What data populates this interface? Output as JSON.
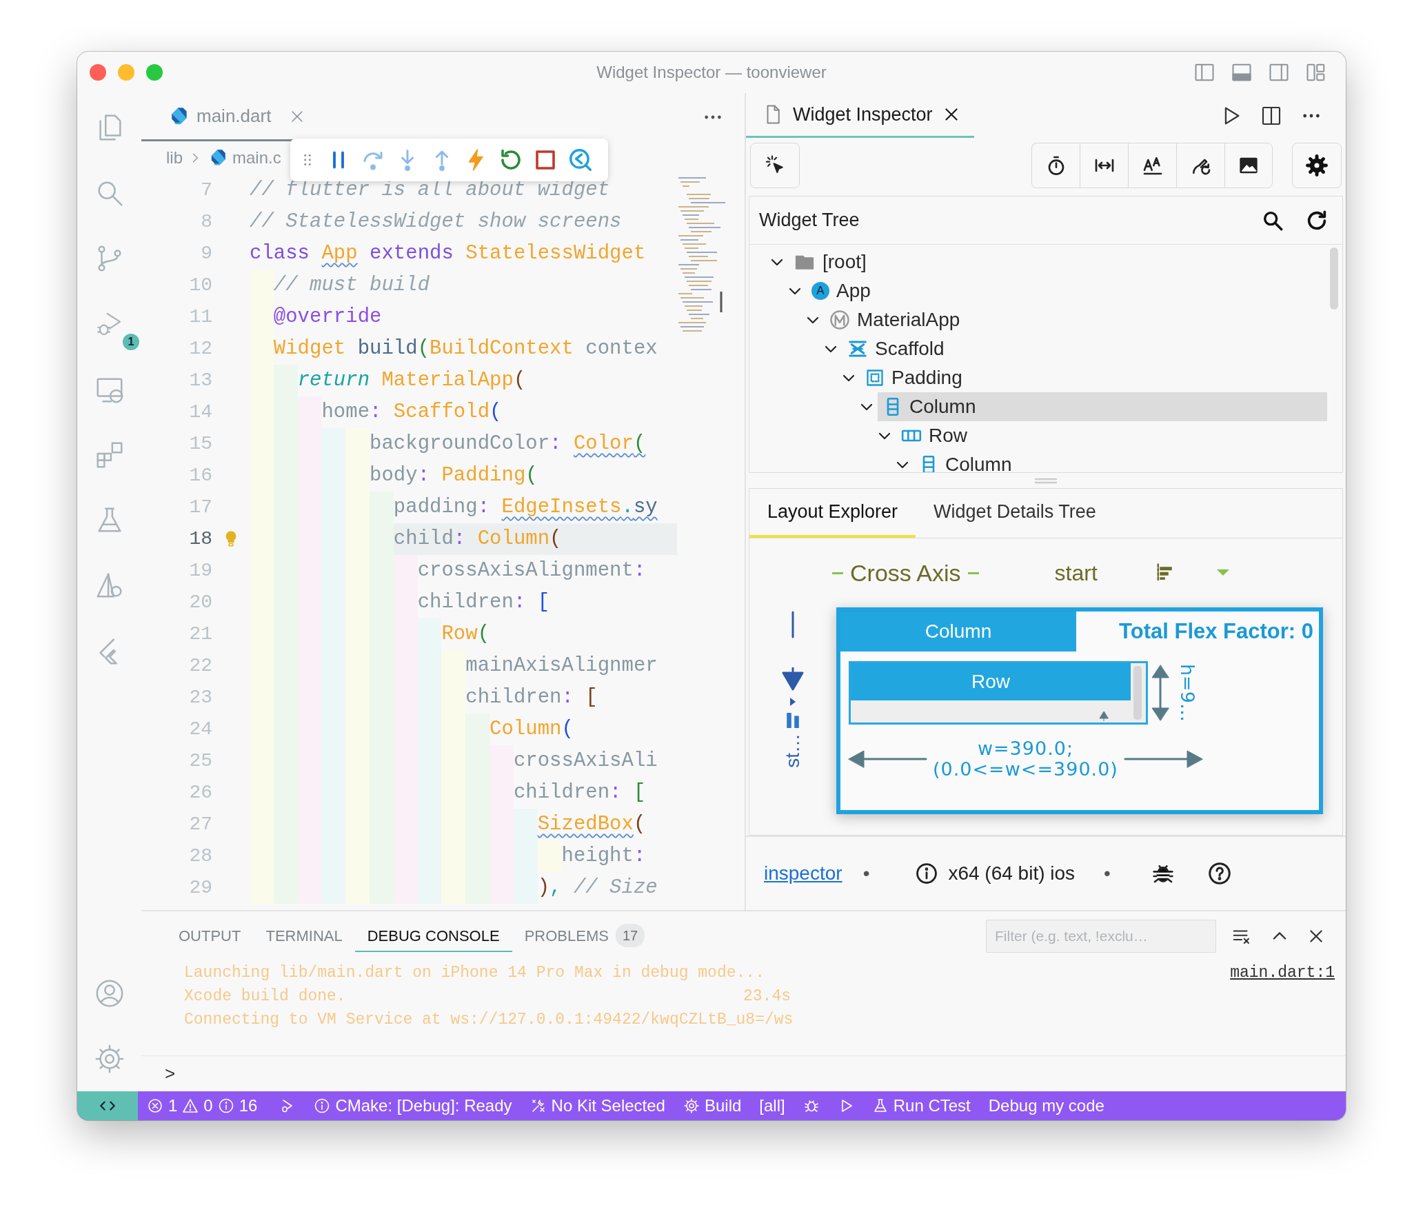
{
  "window": {
    "title": "Widget Inspector — toonviewer"
  },
  "activity_bar": {
    "debug_badge": "1"
  },
  "editor": {
    "tab": "main.dart",
    "breadcrumb": {
      "folder": "lib",
      "file": "main.c"
    },
    "lines": [
      {
        "number": "7",
        "current": false,
        "lightbulb": false,
        "tokens": [
          {
            "text": "// flutter is all about widget",
            "kind": "comment",
            "warning": false
          }
        ]
      },
      {
        "number": "8",
        "current": false,
        "lightbulb": false,
        "tokens": [
          {
            "text": "// StatelessWidget show screens",
            "kind": "comment",
            "warning": false
          }
        ]
      },
      {
        "number": "9",
        "current": false,
        "lightbulb": false,
        "tokens": [
          {
            "text": "class ",
            "kind": "keyword",
            "warning": false
          },
          {
            "text": "App",
            "kind": "type",
            "warning": true
          },
          {
            "text": " extends ",
            "kind": "keyword",
            "warning": false
          },
          {
            "text": "StatelessWidget",
            "kind": "type",
            "warning": false
          }
        ]
      },
      {
        "number": "10",
        "current": false,
        "lightbulb": false,
        "tokens": [
          {
            "text": "  // must build",
            "kind": "comment",
            "warning": false
          }
        ]
      },
      {
        "number": "11",
        "current": false,
        "lightbulb": false,
        "tokens": [
          {
            "text": "  @override",
            "kind": "annotation",
            "warning": false
          }
        ]
      },
      {
        "number": "12",
        "current": false,
        "lightbulb": false,
        "tokens": [
          {
            "text": "  Widget",
            "kind": "type",
            "warning": false
          },
          {
            "text": " build",
            "kind": "method",
            "warning": false
          },
          {
            "text": "(",
            "kind": "bracket",
            "color": "#2e8b3a",
            "warning": false
          },
          {
            "text": "BuildContext",
            "kind": "type",
            "warning": false
          },
          {
            "text": " contex",
            "kind": "plain",
            "warning": false
          }
        ]
      },
      {
        "number": "13",
        "current": false,
        "lightbulb": false,
        "tokens": [
          {
            "text": "    return",
            "kind": "control",
            "warning": false
          },
          {
            "text": " MaterialApp",
            "kind": "type",
            "warning": false
          },
          {
            "text": "(",
            "kind": "bracket",
            "color": "#7a3e1d",
            "warning": false
          }
        ]
      },
      {
        "number": "14",
        "current": false,
        "lightbulb": false,
        "tokens": [
          {
            "text": "      home",
            "kind": "plain",
            "warning": false
          },
          {
            "text": ": ",
            "kind": "punct",
            "warning": false
          },
          {
            "text": "Scaffold",
            "kind": "type",
            "warning": false
          },
          {
            "text": "(",
            "kind": "bracket",
            "color": "#1f4fe0",
            "warning": false
          }
        ]
      },
      {
        "number": "15",
        "current": false,
        "lightbulb": false,
        "tokens": [
          {
            "text": "          backgroundColor",
            "kind": "plain",
            "warning": false
          },
          {
            "text": ": ",
            "kind": "punct",
            "warning": false
          },
          {
            "text": "Color",
            "kind": "type",
            "warning": true
          },
          {
            "text": "(",
            "kind": "bracket",
            "color": "#2e8b3a",
            "warning": true
          }
        ]
      },
      {
        "number": "16",
        "current": false,
        "lightbulb": false,
        "tokens": [
          {
            "text": "          body",
            "kind": "plain",
            "warning": false
          },
          {
            "text": ": ",
            "kind": "punct",
            "warning": false
          },
          {
            "text": "Padding",
            "kind": "type",
            "warning": false
          },
          {
            "text": "(",
            "kind": "bracket",
            "color": "#2e8b3a",
            "warning": false
          }
        ]
      },
      {
        "number": "17",
        "current": false,
        "lightbulb": false,
        "tokens": [
          {
            "text": "            padding",
            "kind": "plain",
            "warning": false
          },
          {
            "text": ": ",
            "kind": "punct",
            "warning": false
          },
          {
            "text": "EdgeInsets",
            "kind": "type",
            "warning": true
          },
          {
            "text": ".",
            "kind": "dot",
            "warning": true
          },
          {
            "text": "sy",
            "kind": "method",
            "warning": true
          }
        ]
      },
      {
        "number": "18",
        "current": true,
        "lightbulb": true,
        "tokens": [
          {
            "text": "            child",
            "kind": "plain",
            "warning": false
          },
          {
            "text": ": ",
            "kind": "punct",
            "warning": false
          },
          {
            "text": "Column",
            "kind": "type",
            "warning": false
          },
          {
            "text": "(",
            "kind": "bracket",
            "color": "#7a3e1d",
            "warning": false
          }
        ]
      },
      {
        "number": "19",
        "current": false,
        "lightbulb": false,
        "tokens": [
          {
            "text": "              crossAxisAlignment",
            "kind": "plain",
            "warning": false
          },
          {
            "text": ":",
            "kind": "punct",
            "warning": false
          }
        ]
      },
      {
        "number": "20",
        "current": false,
        "lightbulb": false,
        "tokens": [
          {
            "text": "              children",
            "kind": "plain",
            "warning": false
          },
          {
            "text": ": ",
            "kind": "punct",
            "warning": false
          },
          {
            "text": "[",
            "kind": "bracket",
            "color": "#1f4fe0",
            "warning": false
          }
        ]
      },
      {
        "number": "21",
        "current": false,
        "lightbulb": false,
        "tokens": [
          {
            "text": "                Row",
            "kind": "type",
            "warning": false
          },
          {
            "text": "(",
            "kind": "bracket",
            "color": "#2e8b3a",
            "warning": false
          }
        ]
      },
      {
        "number": "22",
        "current": false,
        "lightbulb": false,
        "tokens": [
          {
            "text": "                  mainAxisAlignmer",
            "kind": "plain",
            "warning": false
          }
        ]
      },
      {
        "number": "23",
        "current": false,
        "lightbulb": false,
        "tokens": [
          {
            "text": "                  children",
            "kind": "plain",
            "warning": false
          },
          {
            "text": ": ",
            "kind": "punct",
            "warning": false
          },
          {
            "text": "[",
            "kind": "bracket",
            "color": "#7a3e1d",
            "warning": false
          }
        ]
      },
      {
        "number": "24",
        "current": false,
        "lightbulb": false,
        "tokens": [
          {
            "text": "                    Column",
            "kind": "type",
            "warning": false
          },
          {
            "text": "(",
            "kind": "bracket",
            "color": "#1f4fe0",
            "warning": false
          }
        ]
      },
      {
        "number": "25",
        "current": false,
        "lightbulb": false,
        "tokens": [
          {
            "text": "                      crossAxisAli",
            "kind": "plain",
            "warning": false
          }
        ]
      },
      {
        "number": "26",
        "current": false,
        "lightbulb": false,
        "tokens": [
          {
            "text": "                      children",
            "kind": "plain",
            "warning": false
          },
          {
            "text": ": ",
            "kind": "punct",
            "warning": false
          },
          {
            "text": "[",
            "kind": "bracket",
            "color": "#2e8b3a",
            "warning": false
          }
        ]
      },
      {
        "number": "27",
        "current": false,
        "lightbulb": false,
        "tokens": [
          {
            "text": "                        SizedBox",
            "kind": "type",
            "warning": true
          },
          {
            "text": "(",
            "kind": "bracket",
            "color": "#7a3e1d",
            "warning": false
          }
        ]
      },
      {
        "number": "28",
        "current": false,
        "lightbulb": false,
        "tokens": [
          {
            "text": "                          height",
            "kind": "plain",
            "warning": false
          },
          {
            "text": ":",
            "kind": "punct",
            "warning": false
          }
        ]
      },
      {
        "number": "29",
        "current": false,
        "lightbulb": false,
        "tokens": [
          {
            "text": "                        )",
            "kind": "bracket",
            "color": "#7a3e1d",
            "warning": false
          },
          {
            "text": ",",
            "kind": "dot",
            "warning": false
          },
          {
            "text": " // Size",
            "kind": "comment",
            "warning": false
          }
        ]
      }
    ]
  },
  "inspector": {
    "tab": "Widget Inspector",
    "tree": {
      "title": "Widget Tree",
      "nodes": [
        {
          "label": "[root]",
          "kind": "folder",
          "expanded": true,
          "selected": false,
          "children": [
            {
              "label": "App",
              "kind": "app",
              "icon_letter": "A",
              "expanded": true,
              "selected": false,
              "children": [
                {
                  "label": "MaterialApp",
                  "kind": "material",
                  "expanded": true,
                  "selected": false,
                  "children": [
                    {
                      "label": "Scaffold",
                      "kind": "scaffold",
                      "expanded": true,
                      "selected": false,
                      "children": [
                        {
                          "label": "Padding",
                          "kind": "padding",
                          "expanded": true,
                          "selected": false,
                          "children": [
                            {
                              "label": "Column",
                              "kind": "column",
                              "expanded": true,
                              "selected": true,
                              "children": [
                                {
                                  "label": "Row",
                                  "kind": "row",
                                  "expanded": true,
                                  "selected": false,
                                  "children": [
                                    {
                                      "label": "Column",
                                      "kind": "column",
                                      "expanded": true,
                                      "selected": false
                                    }
                                  ]
                                }
                              ]
                            }
                          ]
                        }
                      ]
                    }
                  ]
                }
              ]
            }
          ]
        }
      ]
    },
    "tabs": [
      {
        "label": "Layout Explorer",
        "selected": true
      },
      {
        "label": "Widget Details Tree",
        "selected": false
      }
    ],
    "layout": {
      "axis_label": "Cross Axis",
      "alignment": "start",
      "side_label": "st…",
      "container": "Column",
      "flex_label": "Total Flex Factor: 0",
      "child": "Row",
      "height_label": "h=9…",
      "width_label": "w=390.0;",
      "width_range": "(0.0<=w<=390.0)"
    },
    "footer": {
      "link": "inspector",
      "platform": "x64 (64 bit) ios",
      "separators": [
        "•",
        "•"
      ]
    }
  },
  "panel": {
    "tabs": [
      {
        "label": "OUTPUT",
        "selected": false
      },
      {
        "label": "TERMINAL",
        "selected": false
      },
      {
        "label": "DEBUG CONSOLE",
        "selected": true
      },
      {
        "label": "PROBLEMS",
        "selected": false,
        "count": "17"
      }
    ],
    "filter": {
      "placeholder": "Filter (e.g. text, !exclu…"
    },
    "source_link": "main.dart:1",
    "console": [
      {
        "text": "Launching lib/main.dart on iPhone 14 Pro Max in debug mode..."
      },
      {
        "text": "Xcode build done.",
        "time": "23.4s"
      },
      {
        "text": "Connecting to VM Service at ws://127.0.0.1:49422/kwqCZLtB_u8=/ws"
      }
    ],
    "prompt": ">"
  },
  "status_bar": {
    "problems": {
      "errors": "1",
      "warnings": "0",
      "infos": "16"
    },
    "items": [
      {
        "kind": "launch"
      },
      {
        "kind": "info",
        "text": "CMake: [Debug]: Ready"
      },
      {
        "kind": "tools",
        "text": "No Kit Selected"
      },
      {
        "kind": "gear",
        "text": "Build"
      },
      {
        "kind": "plain",
        "text": "[all]"
      },
      {
        "kind": "bug"
      },
      {
        "kind": "play"
      },
      {
        "kind": "flask",
        "text": "Run CTest"
      },
      {
        "kind": "plain",
        "text": "Debug my code"
      }
    ]
  }
}
